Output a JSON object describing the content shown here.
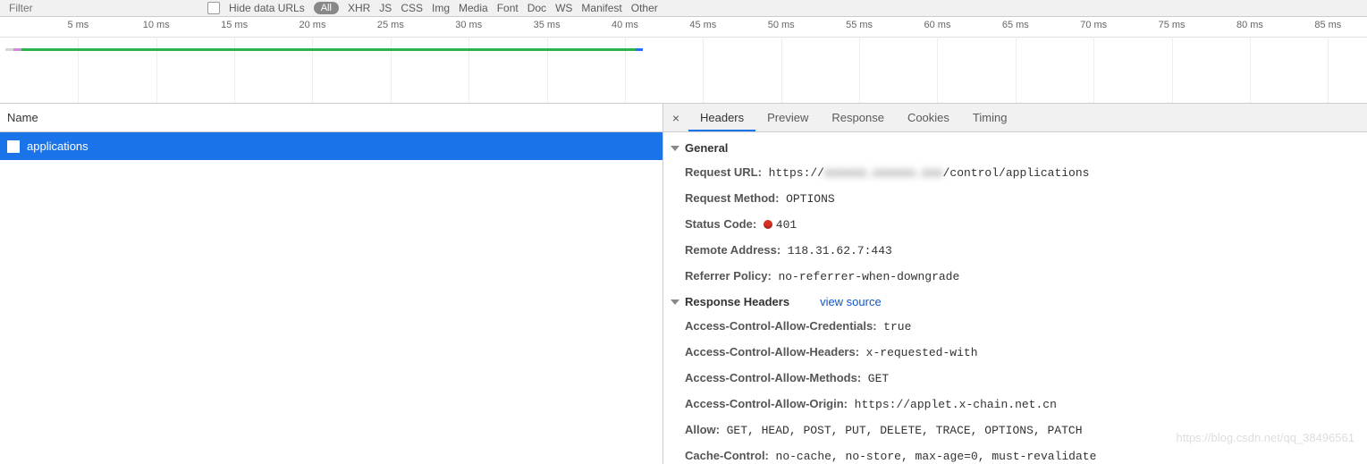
{
  "toolbar": {
    "filter_placeholder": "Filter",
    "hide_label": "Hide data URLs",
    "pills": [
      "All",
      "XHR",
      "JS",
      "CSS",
      "Img",
      "Media",
      "Font",
      "Doc",
      "WS",
      "Manifest",
      "Other"
    ]
  },
  "timeline": {
    "ticks": [
      "5 ms",
      "10 ms",
      "15 ms",
      "20 ms",
      "25 ms",
      "30 ms",
      "35 ms",
      "40 ms",
      "45 ms",
      "50 ms",
      "55 ms",
      "60 ms",
      "65 ms",
      "70 ms",
      "75 ms",
      "80 ms",
      "85 ms"
    ],
    "segments": [
      {
        "start_pct": 0.4,
        "end_pct": 1.0,
        "color": "#d6d6d6"
      },
      {
        "start_pct": 1.0,
        "end_pct": 1.6,
        "color": "#d08bd4"
      },
      {
        "start_pct": 1.6,
        "end_pct": 46.5,
        "color": "#2bb24c"
      },
      {
        "start_pct": 46.5,
        "end_pct": 47.0,
        "color": "#2b6cff"
      }
    ]
  },
  "left": {
    "name_header": "Name",
    "requests": [
      {
        "name": "applications"
      }
    ]
  },
  "tabs": [
    "Headers",
    "Preview",
    "Response",
    "Cookies",
    "Timing"
  ],
  "active_tab": "Headers",
  "headers": {
    "general_title": "General",
    "general": [
      {
        "k": "Request URL:",
        "v": "https://",
        "blur": "xxxxxx.xxxxxx.xxx",
        "tail": "/control/applications"
      },
      {
        "k": "Request Method:",
        "v": "OPTIONS"
      },
      {
        "k": "Status Code:",
        "v": "401",
        "dot": true
      },
      {
        "k": "Remote Address:",
        "v": "118.31.62.7:443"
      },
      {
        "k": "Referrer Policy:",
        "v": "no-referrer-when-downgrade"
      }
    ],
    "response_title": "Response Headers",
    "view_source": "view source",
    "response": [
      {
        "k": "Access-Control-Allow-Credentials:",
        "v": "true"
      },
      {
        "k": "Access-Control-Allow-Headers:",
        "v": "x-requested-with"
      },
      {
        "k": "Access-Control-Allow-Methods:",
        "v": "GET"
      },
      {
        "k": "Access-Control-Allow-Origin:",
        "v": "https://applet.x-chain.net.cn"
      },
      {
        "k": "Allow:",
        "v": "GET, HEAD, POST, PUT, DELETE, TRACE, OPTIONS, PATCH"
      },
      {
        "k": "Cache-Control:",
        "v": "no-cache, no-store, max-age=0, must-revalidate"
      }
    ]
  },
  "watermark": "https://blog.csdn.net/qq_38496561"
}
